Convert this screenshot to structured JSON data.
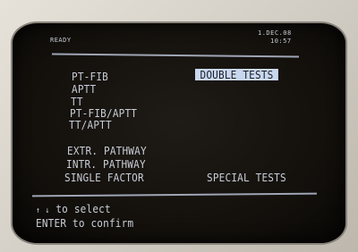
{
  "status": {
    "ready": "READY",
    "date": "1.DEC.08",
    "time": "10:57"
  },
  "menu": {
    "left_items": [
      "PT-FIB",
      "APTT",
      "TT",
      "PT-FIB/APTT",
      "TT/APTT",
      "EXTR. PATHWAY",
      "INTR. PATHWAY",
      "SINGLE FACTOR"
    ],
    "selected": "DOUBLE TESTS",
    "special": "SPECIAL TESTS"
  },
  "help": {
    "arrows": "↑ ↓",
    "select": "to select",
    "confirm": "ENTER to confirm"
  }
}
